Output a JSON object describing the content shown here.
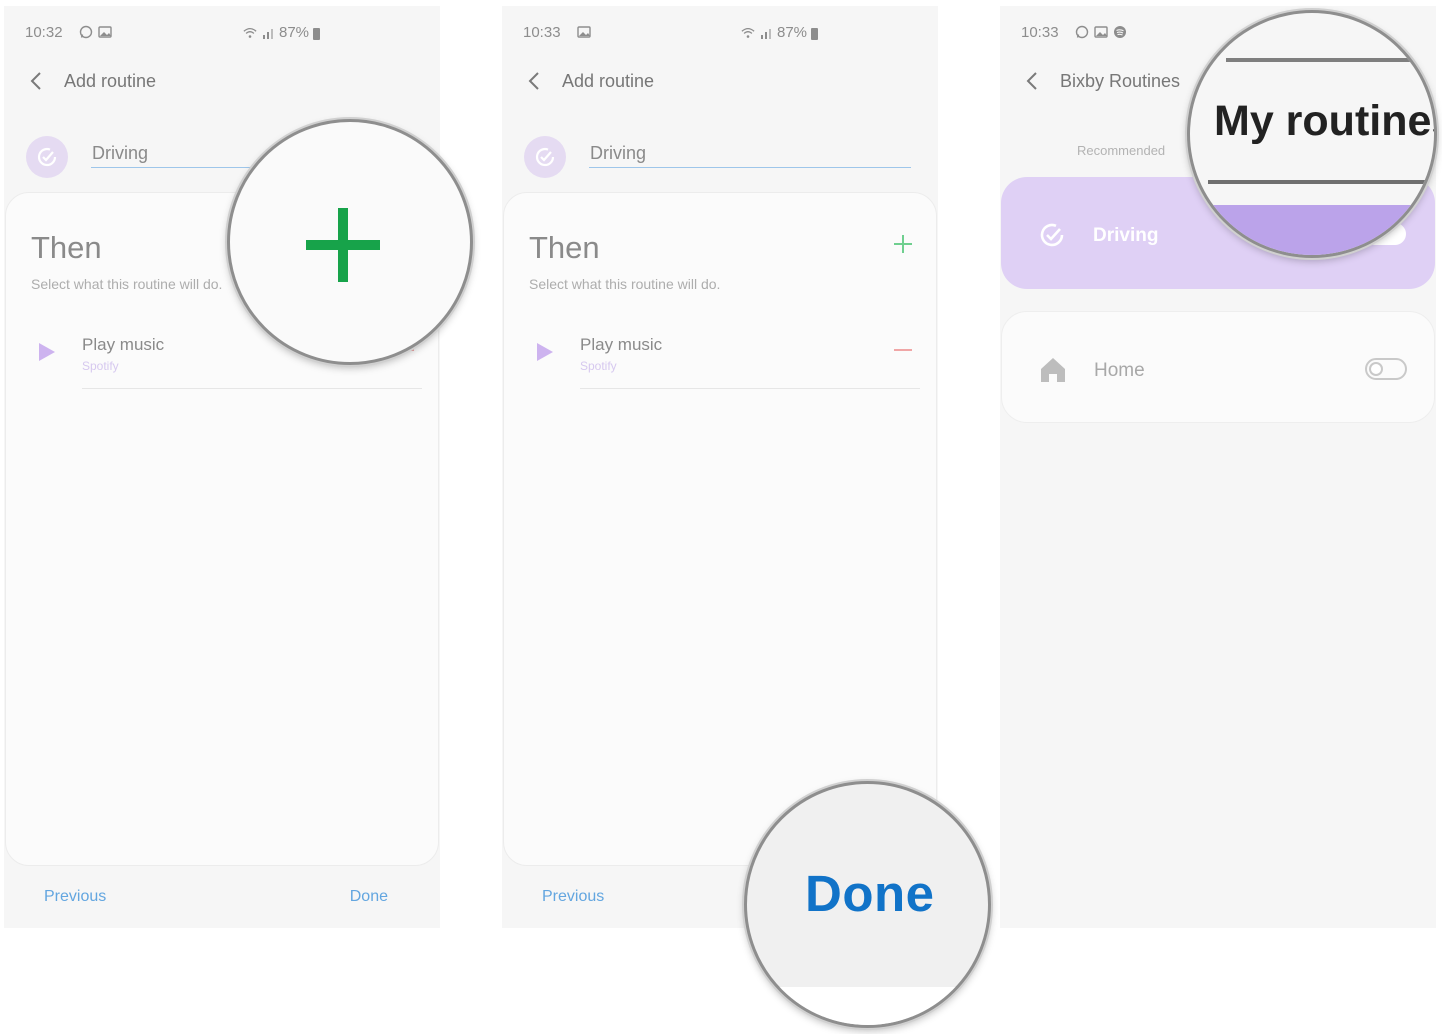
{
  "screens": [
    {
      "status": {
        "time": "10:32",
        "battery": "87%"
      },
      "appbar": {
        "title": "Add routine"
      },
      "routine_name": "Driving",
      "card": {
        "heading": "Then",
        "subtitle": "Select what this routine will do.",
        "action": {
          "title": "Play music",
          "subtitle": "Spotify"
        }
      },
      "footer": {
        "previous": "Previous",
        "done": "Done"
      }
    },
    {
      "status": {
        "time": "10:33",
        "battery": "87%"
      },
      "appbar": {
        "title": "Add routine"
      },
      "routine_name": "Driving",
      "card": {
        "heading": "Then",
        "subtitle": "Select what this routine will do.",
        "action": {
          "title": "Play music",
          "subtitle": "Spotify"
        }
      },
      "footer": {
        "previous": "Previous",
        "done": "Done"
      }
    },
    {
      "status": {
        "time": "10:33"
      },
      "appbar": {
        "title": "Bixby Routines"
      },
      "tabs": {
        "recommended": "Recommended",
        "my_routines": "My routines"
      },
      "routines": [
        {
          "name": "Driving",
          "enabled": true,
          "icon": "routine-check-icon"
        },
        {
          "name": "Home",
          "enabled": false,
          "icon": "home-icon"
        }
      ]
    }
  ],
  "callouts": {
    "plus": {
      "icon": "plus-icon",
      "color": "#17a34a"
    },
    "done": {
      "label": "Done",
      "color": "#1173c8"
    },
    "my_routines": {
      "label": "My routines"
    }
  },
  "colors": {
    "accent_lilac": "#dfd0f5",
    "link_blue": "#63a6e0",
    "add_green": "#6fcf8f",
    "remove_red": "#f0a6a6"
  }
}
